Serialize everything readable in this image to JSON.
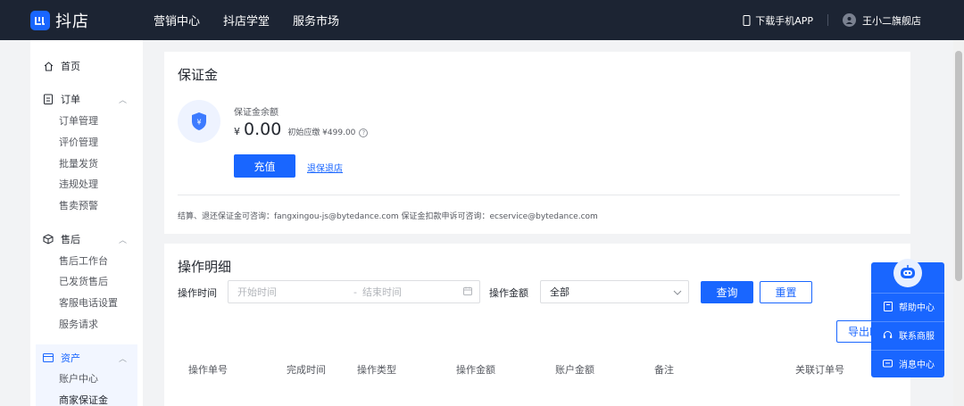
{
  "topbar": {
    "logo_text": "抖店",
    "nav": [
      "营销中心",
      "抖店学堂",
      "服务市场"
    ],
    "download_app": "下载手机APP",
    "store_name": "王小二旗舰店"
  },
  "sidebar": {
    "home": "首页",
    "groups": [
      {
        "label": "订单",
        "items": [
          "订单管理",
          "评价管理",
          "批量发货",
          "违规处理",
          "售卖预警"
        ]
      },
      {
        "label": "售后",
        "items": [
          "售后工作台",
          "已发货售后",
          "客服电话设置",
          "服务请求"
        ]
      },
      {
        "label": "资产",
        "items": [
          "账户中心",
          "商家保证金"
        ]
      }
    ]
  },
  "deposit": {
    "title": "保证金",
    "balance_label": "保证金余额",
    "currency": "¥",
    "balance": "0.00",
    "initial_due": "初始应缴 ¥499.00",
    "recharge_btn": "充值",
    "refund_link": "退保退店",
    "contact_note": "结算、退还保证金可咨询：fangxingou-js@bytedance.com  保证金扣款申诉可咨询：ecservice@bytedance.com"
  },
  "details": {
    "title": "操作明细",
    "time_label": "操作时间",
    "start_placeholder": "开始时间",
    "range_sep": "-",
    "end_placeholder": "结束时间",
    "amount_label": "操作金额",
    "amount_value": "全部",
    "query_btn": "查询",
    "reset_btn": "重置",
    "export_btn": "导出E",
    "columns": [
      "操作单号",
      "完成时间",
      "操作类型",
      "操作金额",
      "账户金额",
      "备注",
      "关联订单号"
    ]
  },
  "widget": {
    "items": [
      "帮助中心",
      "联系商服",
      "消息中心"
    ]
  },
  "colors": {
    "accent": "#1966ff",
    "topbar": "#1c2433"
  }
}
